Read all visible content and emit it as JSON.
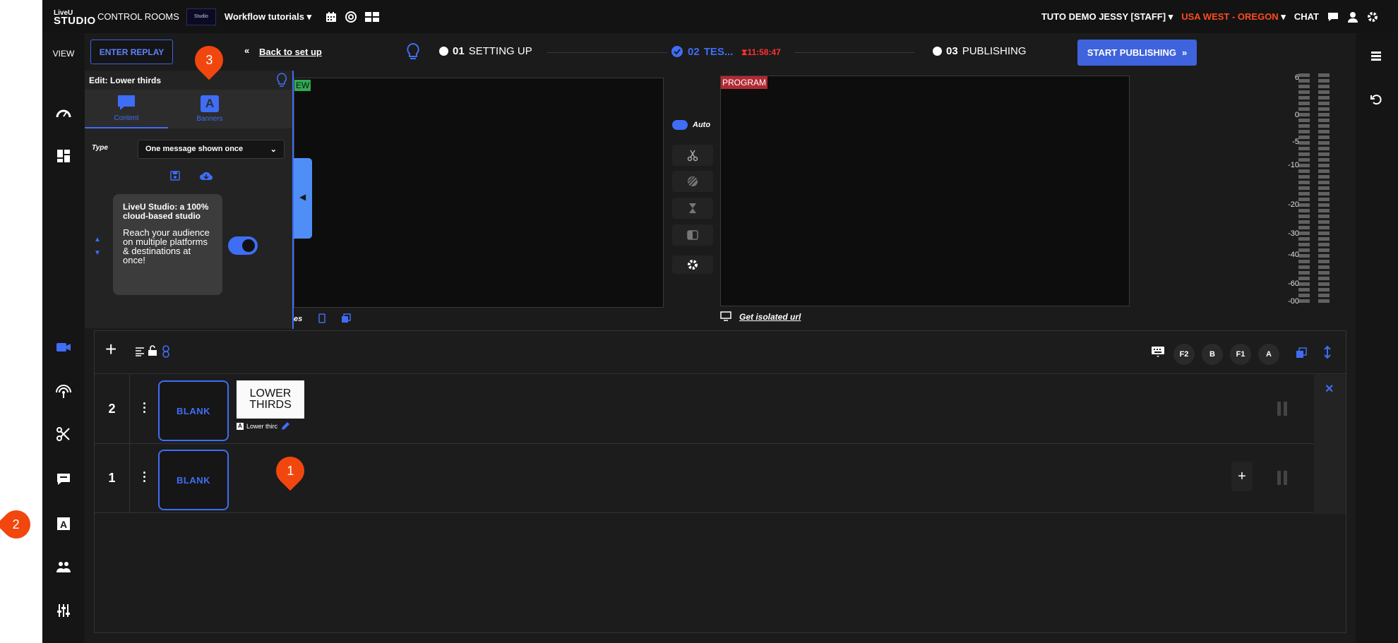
{
  "topbar": {
    "logo_line1": "LiveU",
    "logo_line2": "STUDIO",
    "control_rooms": "CONTROL ROOMS",
    "thumb_text": "Studio",
    "workflow": "Workflow tutorials",
    "user": "TUTO DEMO JESSY [STAFF]",
    "region": "USA WEST - OREGON",
    "chat": "CHAT"
  },
  "leftrail": {
    "view_label": "VIEW"
  },
  "controls": {
    "enter_replay": "ENTER REPLAY",
    "back_link": "Back to set up",
    "start_publishing": "START PUBLISHING"
  },
  "steps": [
    {
      "num": "01",
      "label": "SETTING UP"
    },
    {
      "num": "02",
      "label": "TES..."
    },
    {
      "num": "03",
      "label": "PUBLISHING"
    }
  ],
  "timer": "11:58:47",
  "edit_panel": {
    "title": "Edit: Lower thirds",
    "tab_content": "Content",
    "tab_banners": "Banners",
    "type_label": "Type",
    "type_value": "One message shown once",
    "message_title": "LiveU Studio: a 100% cloud-based studio",
    "message_body": "Reach your audience on multiple platforms & destinations at once!"
  },
  "preview": {
    "label": "EW",
    "bottom_label": "es"
  },
  "program": {
    "label": "PROGRAM",
    "isolated_link": "Get isolated url"
  },
  "auto_label": "Auto",
  "meter": {
    "scale": [
      "6",
      "0",
      "-5",
      "-10",
      "-20",
      "-30",
      "-40",
      "-60",
      "-00"
    ]
  },
  "rundown": {
    "pills": [
      "F2",
      "B",
      "F1",
      "A"
    ],
    "rows": [
      {
        "num": "2",
        "blank": "BLANK",
        "lower_thirds_line1": "LOWER",
        "lower_thirds_line2": "THIRDS",
        "caption": "Lower thirc"
      },
      {
        "num": "1",
        "blank": "BLANK"
      }
    ]
  },
  "callouts": [
    "1",
    "2",
    "3"
  ],
  "colors": {
    "accent": "#3f6df5",
    "region": "#ff4b1e",
    "program": "#b02a34",
    "callout": "#f2460f"
  }
}
